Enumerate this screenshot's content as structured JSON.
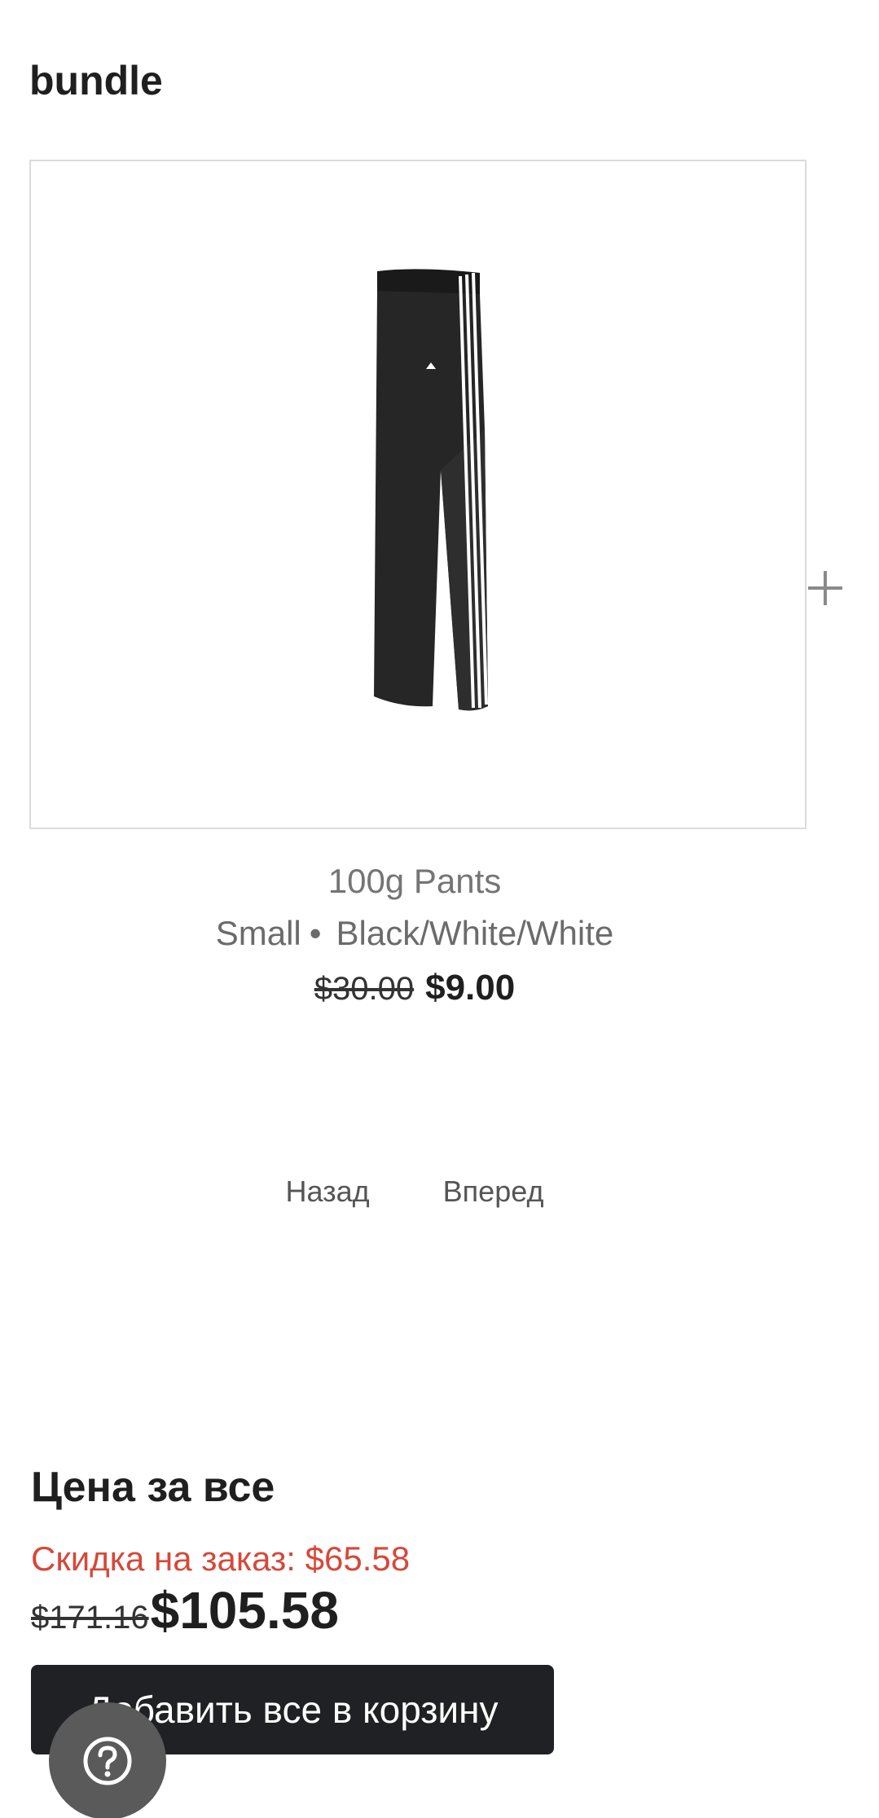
{
  "bundle": {
    "title": "bundle"
  },
  "product": {
    "image_icon": "track-pants-image",
    "name": "100g Pants",
    "size": "Small",
    "separator": "•",
    "color": "Black/White/White",
    "old_price": "$30.00",
    "new_price": "$9.00"
  },
  "carousel": {
    "next_item_icon": "plus-icon",
    "back_label": "Назад",
    "forward_label": "Вперед"
  },
  "total": {
    "title": "Цена за все",
    "discount_label": "Скидка на заказ: $65.58",
    "old_price": "$171.16",
    "new_price": "$105.58",
    "add_all_label": "Добавить все в корзину"
  },
  "help": {
    "icon": "question-icon"
  },
  "colors": {
    "discount": "#d6483a",
    "button_bg": "#1f2124",
    "help_bg": "#5a5a5a",
    "border": "#dcdcdc"
  }
}
